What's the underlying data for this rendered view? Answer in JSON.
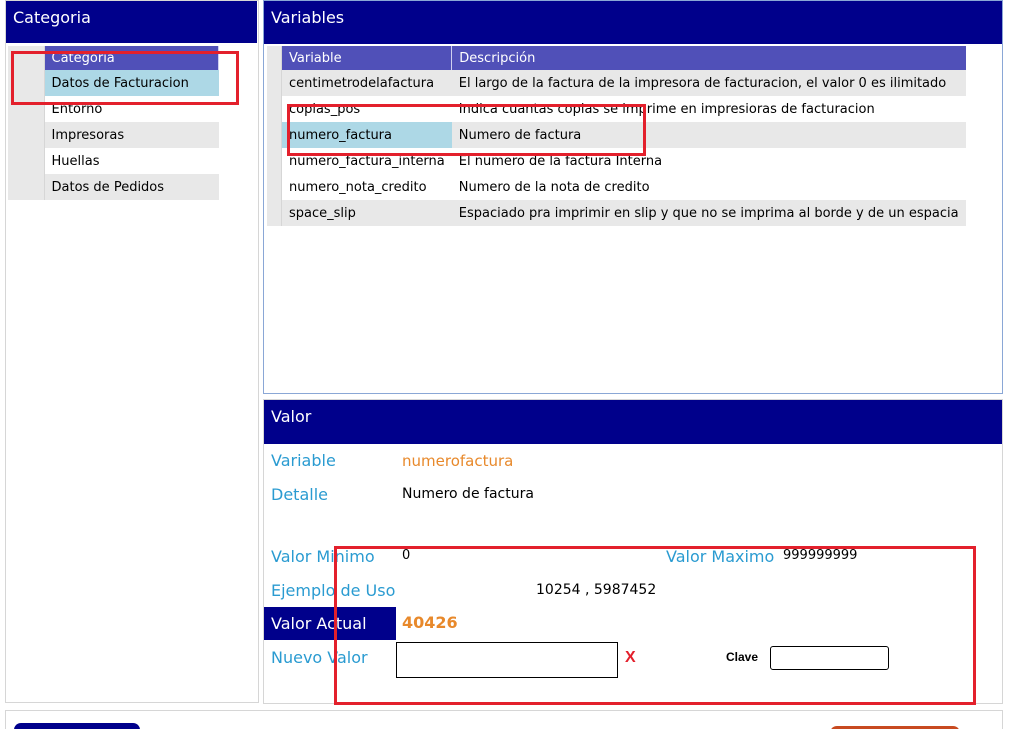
{
  "categoria_panel": {
    "title": "Categoria",
    "column_header": "Categoria",
    "items": [
      {
        "label": "Datos de Facturacion",
        "selected": true
      },
      {
        "label": "Entorno",
        "selected": false
      },
      {
        "label": "Impresoras",
        "selected": false
      },
      {
        "label": "Huellas",
        "selected": false
      },
      {
        "label": "Datos de Pedidos",
        "selected": false
      }
    ]
  },
  "variables_panel": {
    "title": "Variables",
    "headers": {
      "variable": "Variable",
      "descripcion": "Descripción"
    },
    "rows": [
      {
        "variable": "centimetrodelafactura",
        "descripcion": "El largo de la factura de la impresora de facturacion, el valor 0 es ilimitado"
      },
      {
        "variable": "copias_pos",
        "descripcion": "Indica cuantas copias se imprime en impresioras de facturacion"
      },
      {
        "variable": "numero_factura",
        "descripcion": "Numero de factura",
        "selected": true
      },
      {
        "variable": "numero_factura_interna",
        "descripcion": "El numero de la factura Interna"
      },
      {
        "variable": "numero_nota_credito",
        "descripcion": "Numero de la nota de credito"
      },
      {
        "variable": "space_slip",
        "descripcion": "Espaciado pra imprimir en slip y que no se imprima al borde y de un espacia"
      }
    ]
  },
  "valor_panel": {
    "title": "Valor",
    "variable_label": "Variable",
    "variable_value": "numerofactura",
    "detalle_label": "Detalle",
    "detalle_value": "Numero de factura",
    "minimo_label": "Valor Minimo",
    "minimo_value": "0",
    "maximo_label": "Valor Maximo",
    "maximo_value": "999999999",
    "ejemplo_label": "Ejemplo de Uso",
    "ejemplo_value": "10254 , 5987452",
    "actual_label": "Valor Actual",
    "actual_value": "40426",
    "nuevo_label": "Nuevo Valor",
    "nuevo_value": "",
    "clear_mark": "X",
    "clave_label": "Clave",
    "clave_value": ""
  },
  "colors": {
    "header_bg": "#00008b",
    "grid_header_bg": "#5050b8",
    "selected_row": "#add8e6",
    "label_blue": "#2a9bd1",
    "value_orange": "#e8892b",
    "annotation_red": "#e3202c"
  }
}
